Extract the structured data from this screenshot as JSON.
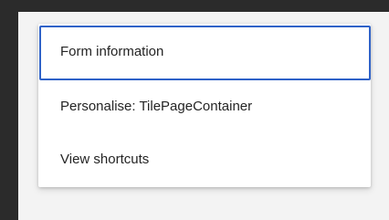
{
  "context_menu": {
    "items": [
      {
        "label": "Form information",
        "focused": true
      },
      {
        "label": "Personalise: TilePageContainer",
        "focused": false
      },
      {
        "label": "View shortcuts",
        "focused": false
      }
    ]
  },
  "colors": {
    "background": "#2b2b2b",
    "page_surface": "#f3f3f3",
    "menu_background": "#ffffff",
    "focus_outline": "#2f62c8",
    "text": "#242424"
  }
}
